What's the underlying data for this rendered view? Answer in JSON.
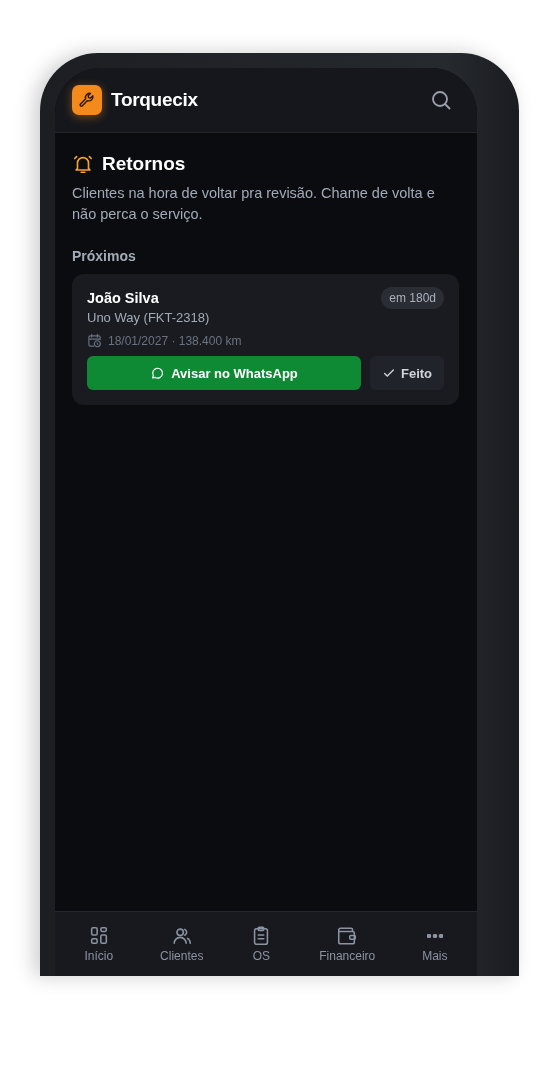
{
  "app": {
    "name": "Torquecix"
  },
  "page": {
    "title": "Retornos",
    "description": "Clientes na hora de voltar pra revisão. Chame de volta e não perca o serviço."
  },
  "section": {
    "title": "Próximos"
  },
  "reminders": [
    {
      "name": "João Silva",
      "vehicle": "Uno Way (FKT-2318)",
      "due": "em 180d",
      "details": "18/01/2027 · 138.400 km",
      "primary_action": "Avisar no WhatsApp",
      "secondary_action": "Feito"
    }
  ],
  "nav": [
    {
      "label": "Início",
      "kind": "grid",
      "selected": false
    },
    {
      "label": "Clientes",
      "kind": "users",
      "selected": false
    },
    {
      "label": "OS",
      "kind": "clipboard",
      "selected": false
    },
    {
      "label": "Financeiro",
      "kind": "wallet",
      "selected": false
    },
    {
      "label": "Mais",
      "kind": "more",
      "selected": false
    }
  ]
}
